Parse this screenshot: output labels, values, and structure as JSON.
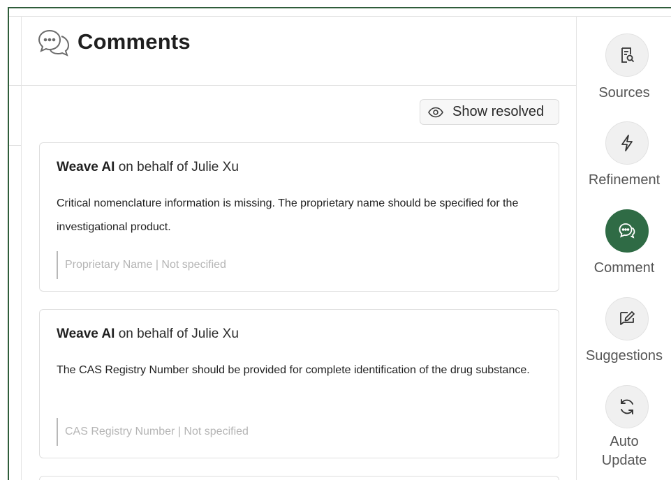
{
  "panel": {
    "title": "Comments",
    "show_resolved_label": "Show resolved"
  },
  "comments": [
    {
      "author": "Weave AI",
      "on_behalf": " on behalf of Julie Xu",
      "body": "Critical nomenclature information is missing. The proprietary name should be specified for the investigational product.",
      "quote": "Proprietary Name | Not specified"
    },
    {
      "author": "Weave AI",
      "on_behalf": " on behalf of Julie Xu",
      "body": "The CAS Registry Number should be provided for complete identification of the drug substance.",
      "quote": "CAS Registry Number | Not specified"
    }
  ],
  "sidebar": {
    "items": [
      {
        "label": "Sources",
        "icon": "sources-icon"
      },
      {
        "label": "Refinement",
        "icon": "lightning-icon"
      },
      {
        "label": "Comment",
        "icon": "comment-icon",
        "active": true
      },
      {
        "label": "Suggestions",
        "icon": "suggestion-edit-icon"
      },
      {
        "label": "Auto\nUpdate",
        "icon": "refresh-icon"
      }
    ]
  },
  "colors": {
    "accent": "#2f6b45",
    "frame": "#2f5d3a",
    "quote_text": "#b5b5b5"
  }
}
